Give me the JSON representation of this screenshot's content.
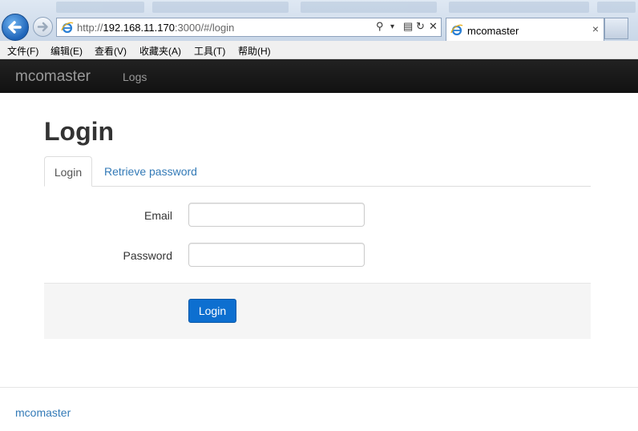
{
  "browser": {
    "url_prefix": "http://",
    "url_host": "192.168.11.170",
    "url_rest": ":3000/#/login",
    "tab_title": "mcomaster",
    "tab_close": "×",
    "addr_search": "⚲",
    "addr_dropdown": "▾",
    "addr_refresh": "↻",
    "addr_stop": "✕"
  },
  "menu": [
    "文件(F)",
    "编辑(E)",
    "查看(V)",
    "收藏夹(A)",
    "工具(T)",
    "帮助(H)"
  ],
  "navbar": {
    "brand": "mcomaster",
    "logs": "Logs"
  },
  "page": {
    "title": "Login",
    "tabs": [
      {
        "label": "Login",
        "active": true
      },
      {
        "label": "Retrieve password",
        "active": false
      }
    ],
    "email_label": "Email",
    "email_value": "",
    "password_label": "Password",
    "password_value": "",
    "submit_label": "Login"
  },
  "footer": {
    "link": "mcomaster"
  },
  "colors": {
    "navbar": "#111111",
    "link": "#337ab7",
    "primary_button": "#0d6fd0"
  }
}
